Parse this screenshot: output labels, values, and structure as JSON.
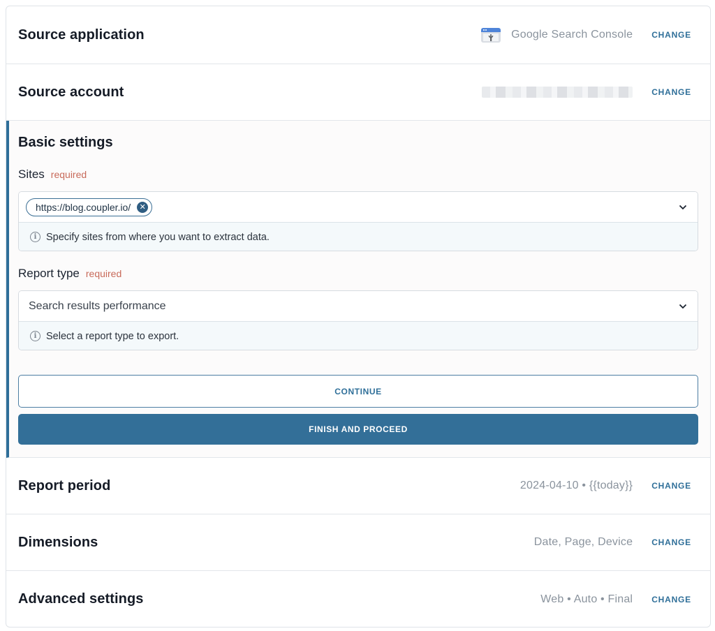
{
  "sections": {
    "source_application": {
      "title": "Source application",
      "value": "Google Search Console",
      "icon": "google-search-console-icon",
      "change_label": "CHANGE"
    },
    "source_account": {
      "title": "Source account",
      "change_label": "CHANGE"
    },
    "basic_settings": {
      "title": "Basic settings",
      "sites": {
        "label": "Sites",
        "required": "required",
        "selected_chip": "https://blog.coupler.io/",
        "hint": "Specify sites from where you want to extract data."
      },
      "report_type": {
        "label": "Report type",
        "required": "required",
        "value": "Search results performance",
        "hint": "Select a report type to export."
      },
      "continue_label": "CONTINUE",
      "finish_label": "FINISH AND PROCEED"
    },
    "report_period": {
      "title": "Report period",
      "value": "2024-04-10 • {{today}}",
      "change_label": "CHANGE"
    },
    "dimensions": {
      "title": "Dimensions",
      "value": "Date, Page, Device",
      "change_label": "CHANGE"
    },
    "advanced_settings": {
      "title": "Advanced settings",
      "value": "Web • Auto • Final",
      "change_label": "CHANGE"
    }
  },
  "colors": {
    "accent": "#2f6f99",
    "primary_button": "#336f98",
    "required_text": "#c86a5a",
    "hint_background": "#f4f9fb"
  }
}
